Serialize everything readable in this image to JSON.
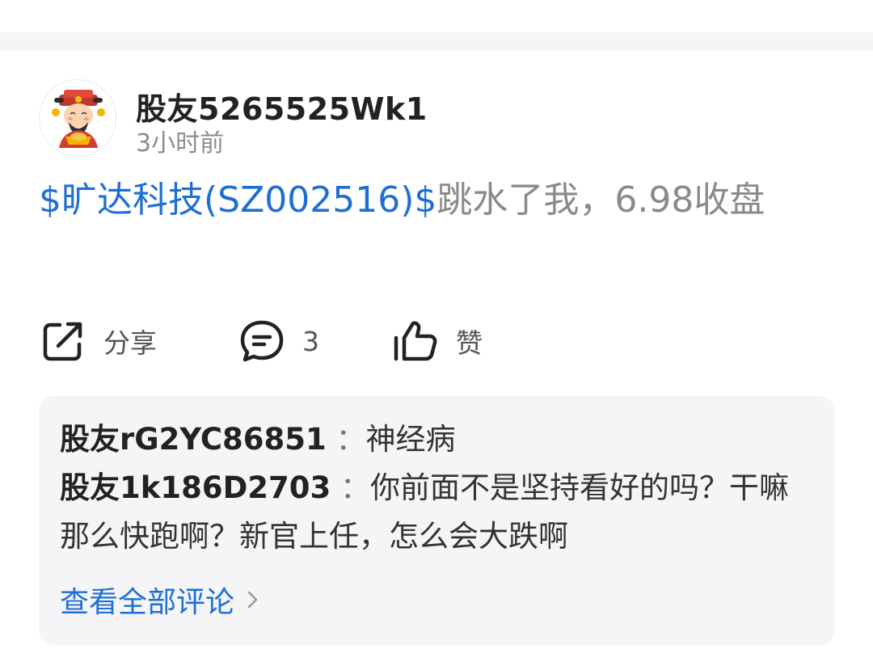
{
  "post": {
    "author": "股友5265525Wk1",
    "time": "3小时前",
    "stock_tag": "$旷达科技(SZ002516)$",
    "text": "跳水了我，6.98收盘"
  },
  "actions": {
    "share_label": "分享",
    "comment_count": "3",
    "like_label": "赞"
  },
  "comments": [
    {
      "user": "股友rG2YC86851",
      "separator": "：",
      "text": "神经病"
    },
    {
      "user": "股友1k186D2703",
      "separator": "：",
      "text": "你前面不是坚持看好的吗？干嘛那么快跑啊？新官上任，怎么会大跌啊"
    }
  ],
  "view_all_label": "查看全部评论",
  "colors": {
    "link_blue": "#1e6fd4",
    "body_gray": "#8a8a8a",
    "panel_bg": "#f5f5f7"
  },
  "icons": {
    "avatar": "cartoon-fortune-god-avatar",
    "share": "share-icon",
    "comment": "comment-bubble-icon",
    "like": "thumbs-up-icon",
    "chevron": "chevron-right-icon"
  }
}
